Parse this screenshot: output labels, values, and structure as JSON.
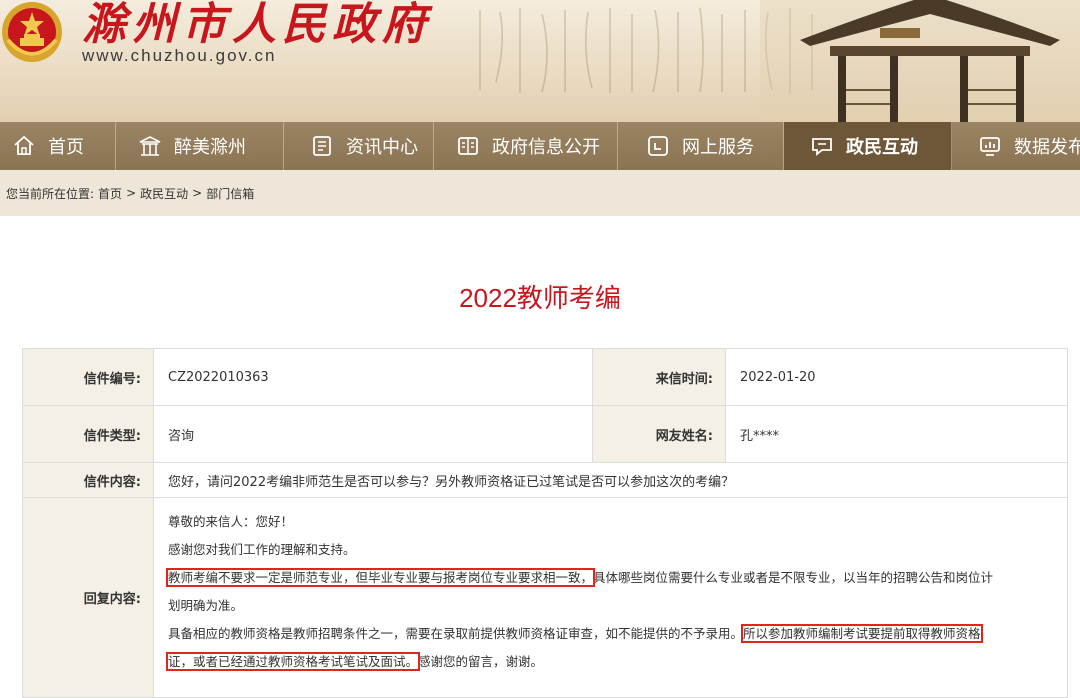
{
  "site": {
    "title": "滁州市人民政府",
    "url": "www.chuzhou.gov.cn"
  },
  "nav": [
    {
      "label": "首页",
      "icon": "home-icon"
    },
    {
      "label": "醉美滁州",
      "icon": "pavilion-icon"
    },
    {
      "label": "资讯中心",
      "icon": "document-icon"
    },
    {
      "label": "政府信息公开",
      "icon": "book-icon"
    },
    {
      "label": "网上服务",
      "icon": "window-icon"
    },
    {
      "label": "政民互动",
      "icon": "chat-icon",
      "active": true
    },
    {
      "label": "数据发布",
      "icon": "chart-icon"
    }
  ],
  "breadcrumb": {
    "prefix": "您当前所在位置:",
    "items": [
      "首页",
      "政民互动",
      "部门信箱"
    ],
    "separator": ">"
  },
  "page_title": "2022教师考编",
  "letter": {
    "number_label": "信件编号:",
    "number": "CZ2022010363",
    "time_label": "来信时间:",
    "time": "2022-01-20",
    "type_label": "信件类型:",
    "type": "咨询",
    "name_label": "网友姓名:",
    "name": "孔****",
    "content_label": "信件内容:",
    "content": "您好，请问2022考编非师范生是否可以参与？另外教师资格证已过笔试是否可以参加这次的考编？",
    "reply_label": "回复内容:",
    "reply": {
      "greeting": "尊敬的来信人：您好！",
      "thanks": "感谢您对我们工作的理解和支持。",
      "p1_highlight": "教师考编不要求一定是师范专业，但毕业专业要与报考岗位专业要求相一致，",
      "p1_rest": "具体哪些岗位需要什么专业或者是不限专业，以当年的招聘公告和岗位计",
      "p1_cont": "划明确为准。",
      "p2_lead": "具备相应的教师资格是教师招聘条件之一，需要在录取前提供教师资格证审查，如不能提供的不予录用。",
      "p2_highlight_a": "所以参加教师编制考试要提前取得教师资格",
      "p2_highlight_b": "证，或者已经通过教师资格考试笔试及面试。",
      "p2_end": "感谢您的留言，谢谢。"
    }
  },
  "colors": {
    "brand_red": "#c8161d",
    "nav_bg": "#8a7453",
    "nav_active": "#6e5638",
    "highlight_box": "#e0261c"
  }
}
